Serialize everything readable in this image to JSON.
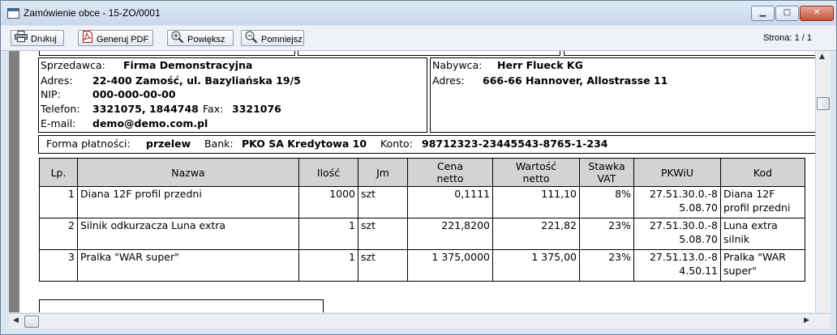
{
  "window": {
    "title": "Zamówienie obce - 15-ZO/0001",
    "min_symbol": "▁",
    "max_symbol": "□",
    "close_symbol": "✕"
  },
  "toolbar": {
    "print_label": "Drukuj",
    "pdf_label": "Generuj PDF",
    "zoom_in_label": "Powiększ",
    "zoom_out_label": "Pomniejsz",
    "page_indicator": "Strona: 1 / 1"
  },
  "seller": {
    "label": "Sprzedawca:",
    "name": "Firma Demonstracyjna",
    "address_label": "Adres:",
    "address": "22-400 Zamość, ul. Bazyliańska 19/5",
    "nip_label": "NIP:",
    "nip": "000-000-00-00",
    "phone_label": "Telefon:",
    "phone": "3321075, 1844748",
    "fax_label": "Fax:",
    "fax": "3321076",
    "email_label": "E-mail:",
    "email": "demo@demo.com.pl"
  },
  "buyer": {
    "label": "Nabywca:",
    "name": "Herr Flueck KG",
    "address_label": "Adres:",
    "address": "666-66 Hannover, Allostrasse 11"
  },
  "payment": {
    "form_label": "Forma płatności:",
    "form": "przelew",
    "bank_label": "Bank:",
    "bank": "PKO SA Kredytowa 10",
    "account_label": "Konto:",
    "account": "98712323-23445543-8765-1-234"
  },
  "table": {
    "headers": {
      "lp": "Lp.",
      "name": "Nazwa",
      "qty": "Ilość",
      "unit": "Jm",
      "price_1": "Cena",
      "price_2": "netto",
      "value_1": "Wartość",
      "value_2": "netto",
      "vat_1": "Stawka",
      "vat_2": "VAT",
      "pkwiu": "PKWiU",
      "code": "Kod"
    },
    "rows": [
      {
        "lp": "1",
        "name": "Diana 12F profil przedni",
        "qty": "1000",
        "unit": "szt",
        "price": "0,1111",
        "value": "111,10",
        "vat": "8%",
        "pkwiu_1": "27.51.30.0.-8",
        "pkwiu_2": "5.08.70",
        "code_1": "Diana 12F",
        "code_2": "profil przedni"
      },
      {
        "lp": "2",
        "name": "Silnik odkurzacza Luna extra",
        "qty": "1",
        "unit": "szt",
        "price": "221,8200",
        "value": "221,82",
        "vat": "23%",
        "pkwiu_1": "27.51.30.0.-8",
        "pkwiu_2": "5.08.70",
        "code_1": "Luna extra",
        "code_2": "silnik"
      },
      {
        "lp": "3",
        "name": "Pralka \"WAR super\"",
        "qty": "1",
        "unit": "szt",
        "price": "1 375,0000",
        "value": "1 375,00",
        "vat": "23%",
        "pkwiu_1": "27.51.13.0.-8",
        "pkwiu_2": "4.50.11",
        "code_1": "Pralka \"WAR",
        "code_2": "super\""
      }
    ]
  },
  "scroll": {
    "up": "▲",
    "down": "▼",
    "left": "◀",
    "right": "▶"
  }
}
